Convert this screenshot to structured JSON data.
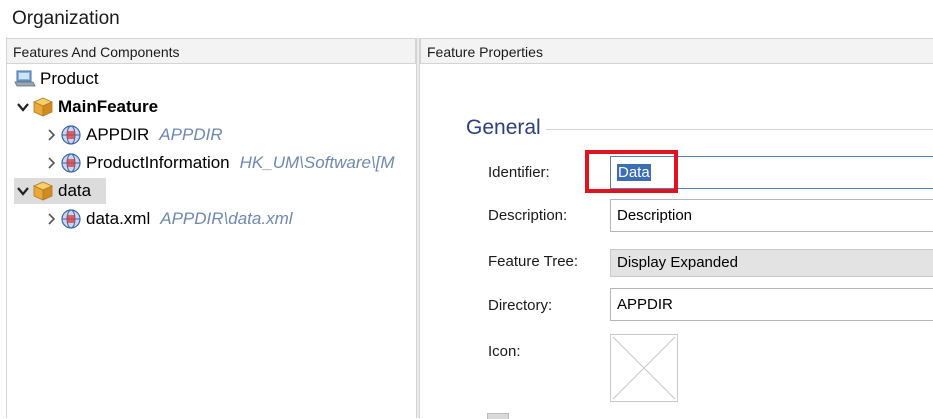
{
  "window": {
    "title": "Organization"
  },
  "left_pane": {
    "header": "Features And Components",
    "tree": [
      {
        "label": "Product",
        "icon": "computer-icon",
        "bold": false,
        "path": ""
      },
      {
        "label": "MainFeature",
        "icon": "package-icon",
        "bold": true,
        "path": ""
      },
      {
        "label": "APPDIR",
        "icon": "globe-component-icon",
        "bold": false,
        "path": "APPDIR"
      },
      {
        "label": "ProductInformation",
        "icon": "globe-component-icon",
        "bold": false,
        "path": "HK_UM\\Software\\[M"
      },
      {
        "label": "data",
        "icon": "package-icon",
        "bold": false,
        "path": "",
        "selected": true
      },
      {
        "label": "data.xml",
        "icon": "globe-component-icon",
        "bold": false,
        "path": "APPDIR\\data.xml"
      }
    ]
  },
  "right_pane": {
    "header": "Feature Properties",
    "section": "General",
    "identifier": {
      "label": "Identifier:",
      "value": "Data"
    },
    "description": {
      "label": "Description:",
      "value": "Description"
    },
    "feature_tree": {
      "label": "Feature Tree:",
      "value": "Display Expanded"
    },
    "directory": {
      "label": "Directory:",
      "value": "APPDIR"
    },
    "icon": {
      "label": "Icon:"
    }
  },
  "colors": {
    "accent": "#2b3f7e",
    "highlight": "#e0141e",
    "path_text": "#6f88b0",
    "selection": "#3d6eb5"
  }
}
